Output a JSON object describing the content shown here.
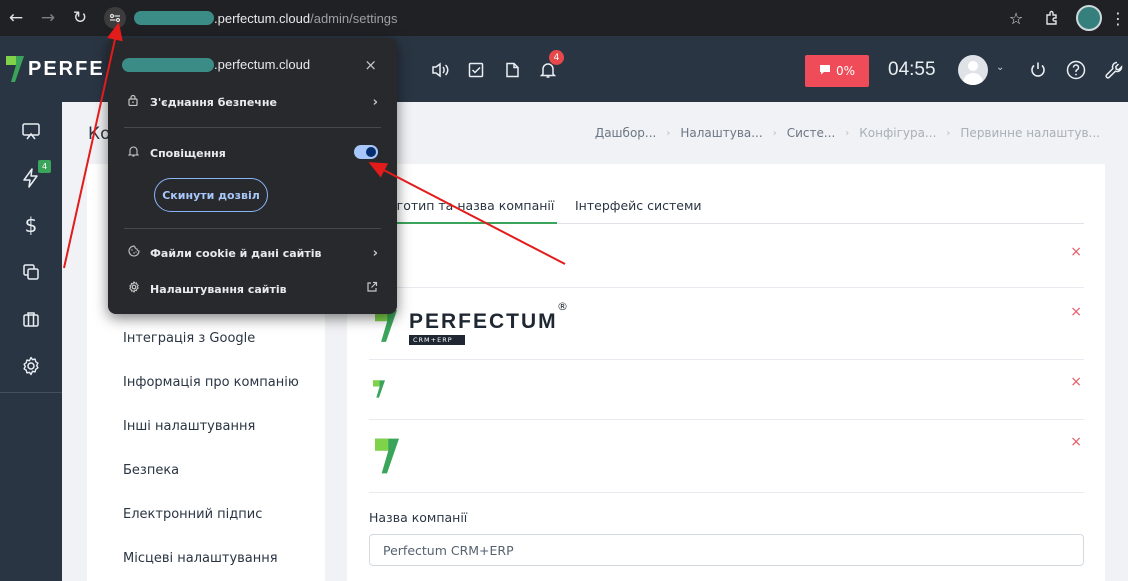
{
  "browser": {
    "url_host": ".perfectum.cloud",
    "url_path": "/admin/settings"
  },
  "header": {
    "logo_text": "PERFE",
    "notifications_badge": "4",
    "progress_label": "0%",
    "progress_value_percent": 0,
    "timer": "04:55"
  },
  "rail": {
    "badge": "4"
  },
  "page": {
    "title": "Ко",
    "breadcrumb": [
      "Дашбор...",
      "Налаштува...",
      "Систе...",
      "Конфігура...",
      "Первинне налаштув..."
    ]
  },
  "settings_menu": {
    "items": [
      "Інтеграція з Google",
      "Інформація про компанію",
      "Інші налаштування",
      "Безпека",
      "Електронний підпис",
      "Місцеві налаштування"
    ]
  },
  "tabs": [
    "логотип та назва компанії",
    "Інтерфейс системи"
  ],
  "logo_rows": {
    "brand_text": "PERFECTUM",
    "brand_sub": "CRM+ERP",
    "registered": "®",
    "remove_symbol": "×"
  },
  "company": {
    "label": "Назва компанії",
    "value": "Perfectum CRM+ERP"
  },
  "popup": {
    "host": ".perfectum.cloud",
    "connection": "З'єднання безпечне",
    "notifications": "Сповіщення",
    "notifications_enabled": true,
    "reset_button": "Скинути дозвіл",
    "cookies": "Файли cookie й дані сайтів",
    "site_settings": "Налаштування сайтів",
    "close_symbol": "×"
  },
  "colors": {
    "header_bg": "#2a3543",
    "accent_green": "#3aa55a",
    "danger": "#ef4b59",
    "annotation_arrow": "#e21b1b"
  }
}
